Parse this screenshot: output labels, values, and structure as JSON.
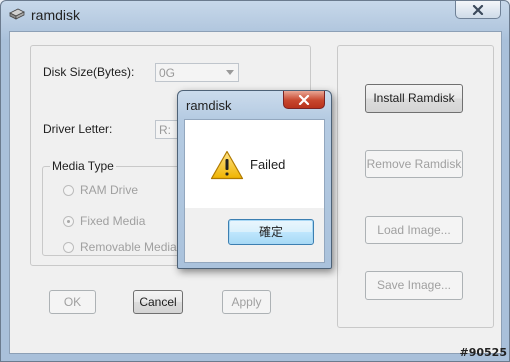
{
  "window": {
    "title": "ramdisk"
  },
  "disk_size": {
    "label": "Disk Size(Bytes):",
    "value": "0G"
  },
  "driver_letter": {
    "label": "Driver Letter:",
    "value": "R:"
  },
  "media_type": {
    "title": "Media Type",
    "options": [
      {
        "label": "RAM Drive",
        "checked": false
      },
      {
        "label": "Fixed Media",
        "checked": true
      },
      {
        "label": "Removable Media",
        "checked": false
      }
    ]
  },
  "buttons": {
    "ok": "OK",
    "cancel": "Cancel",
    "apply": "Apply",
    "install": "Install Ramdisk",
    "remove": "Remove Ramdisk",
    "load": "Load Image...",
    "save": "Save Image..."
  },
  "dialog": {
    "title": "ramdisk",
    "message": "Failed",
    "confirm": "確定"
  },
  "watermark": "#90525"
}
